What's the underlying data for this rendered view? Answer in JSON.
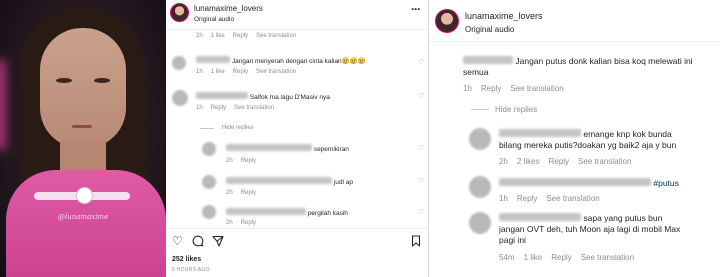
{
  "video": {
    "watermark": "@lunamaxime"
  },
  "left_post": {
    "username": "lunamaxime_lovers",
    "subtitle": "Original audio",
    "more_icon": "more-horizontal-icon",
    "top_meta": {
      "time": "2h",
      "likes": "1 like",
      "reply": "Reply",
      "translate": "See translation"
    },
    "comments": [
      {
        "text": "Jangan menyerah dengan cinta kalian😢😢😢",
        "time": "1h",
        "likes": "1 like",
        "reply": "Reply",
        "translate": "See translation"
      },
      {
        "text": "Salfok ma lagu D'Masiv nya",
        "time": "1h",
        "reply": "Reply",
        "translate": "See translation"
      }
    ],
    "hide_replies": "Hide replies",
    "replies": [
      {
        "text": "sepemikiran",
        "time": "2h",
        "reply": "Reply"
      },
      {
        "text": "judl ap",
        "time": "2h",
        "reply": "Reply"
      },
      {
        "text": "pergilah kasih",
        "time": "2h",
        "reply": "Reply"
      }
    ],
    "footer": {
      "likes": "252 likes",
      "time": "5 HOURS AGO",
      "icons": [
        "heart-icon",
        "comment-icon",
        "share-icon",
        "bookmark-icon"
      ]
    }
  },
  "right_post": {
    "username": "lunamaxime_lovers",
    "subtitle": "Original audio",
    "comments": [
      {
        "text": "Jangan putus donk kalian bisa koq melewati ini semua",
        "time": "1h",
        "reply": "Reply",
        "translate": "See translation"
      }
    ],
    "hide_replies": "Hide replies",
    "replies": [
      {
        "text": "emange knp kok bunda bilang mereka putis?doakan yg baik2 aja y bun",
        "time": "2h",
        "likes": "2 likes",
        "reply": "Reply",
        "translate": "See translation"
      },
      {
        "text": "#putus",
        "time": "1h",
        "reply": "Reply",
        "translate": "See translation"
      },
      {
        "text": "sapa yang putus bun jangan OVT deh, tuh Moon aja lagi di mobil Max pagi ini",
        "time": "54m",
        "likes": "1 like",
        "reply": "Reply",
        "translate": "See translation"
      }
    ]
  }
}
